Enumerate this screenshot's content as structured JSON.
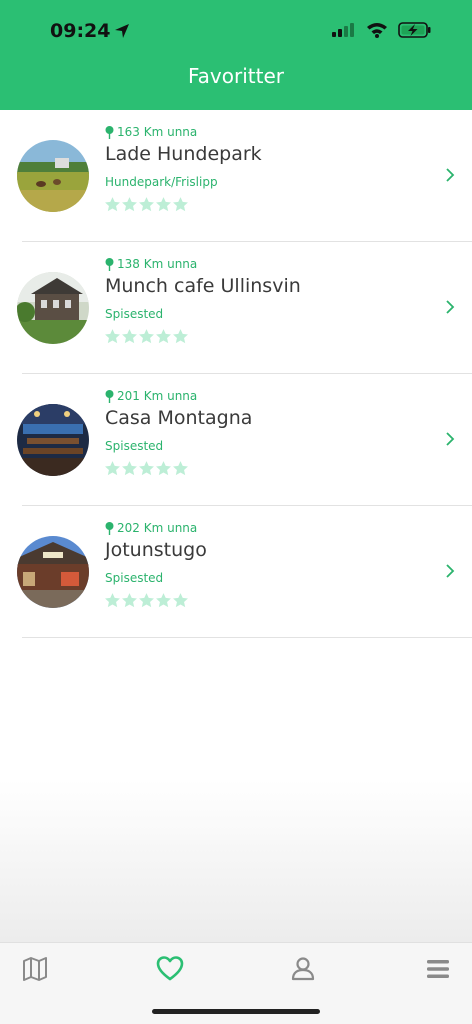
{
  "status": {
    "time": "09:24"
  },
  "header": {
    "title": "Favoritter"
  },
  "favorites": [
    {
      "distance": "163 Km unna",
      "name": "Lade Hundepark",
      "category": "Hundepark/Frislipp",
      "rating": 0
    },
    {
      "distance": "138 Km unna",
      "name": "Munch cafe Ullinsvin",
      "category": "Spisested",
      "rating": 0
    },
    {
      "distance": "201 Km unna",
      "name": "Casa Montagna",
      "category": "Spisested",
      "rating": 0
    },
    {
      "distance": "202 Km unna",
      "name": "Jotunstugo",
      "category": "Spisested",
      "rating": 0
    }
  ],
  "tabbar": {
    "tabs": [
      {
        "icon": "map-icon",
        "active": false
      },
      {
        "icon": "heart-icon",
        "active": true
      },
      {
        "icon": "user-icon",
        "active": false
      },
      {
        "icon": "menu-icon",
        "active": false
      }
    ]
  },
  "colors": {
    "accent": "#2bbf73",
    "star": "#bdeed6",
    "inactive_icon": "#8a8a8a"
  }
}
